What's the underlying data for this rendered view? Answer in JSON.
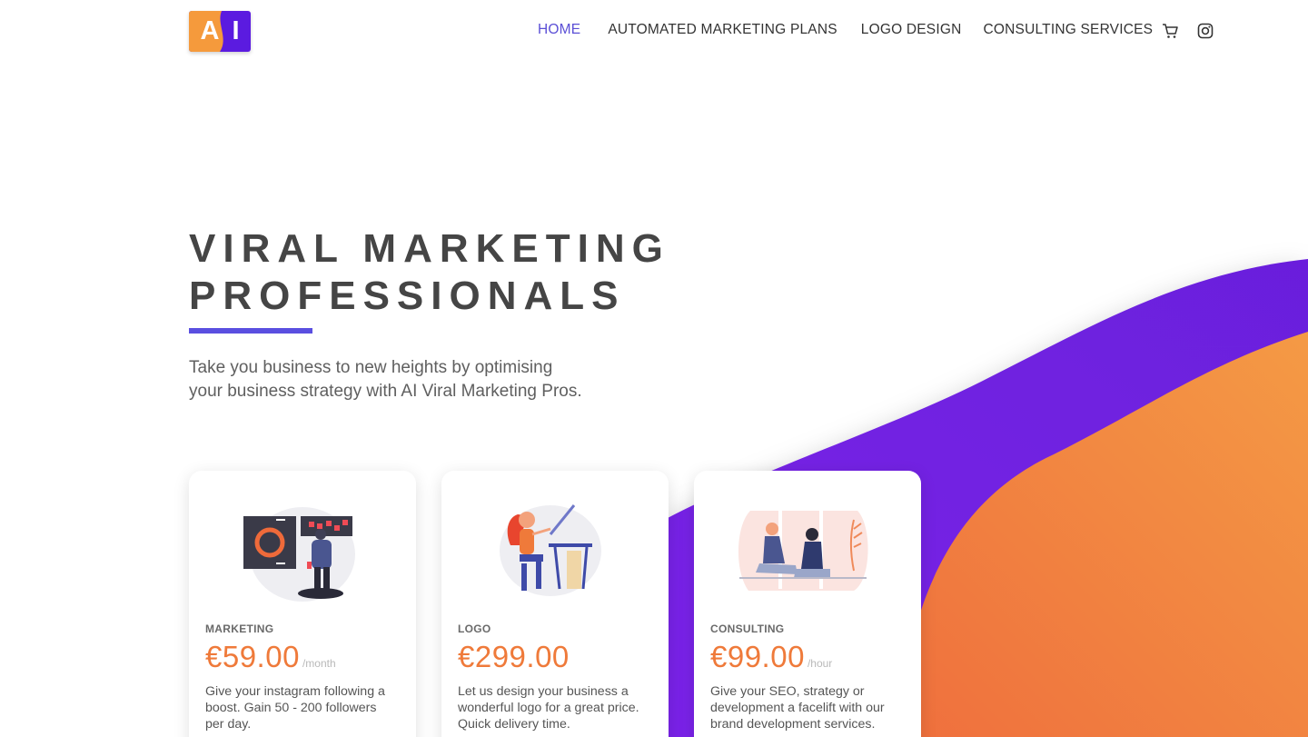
{
  "brand": {
    "logo_letters": [
      "A",
      "I"
    ],
    "colors": {
      "orange": "#f59a3c",
      "purple": "#5b1be0"
    }
  },
  "nav": {
    "items": [
      {
        "label": "HOME",
        "active": true
      },
      {
        "label": "AUTOMATED MARKETING PLANS",
        "active": false
      },
      {
        "label": "LOGO DESIGN",
        "active": false
      },
      {
        "label": "CONSULTING SERVICES",
        "active": false
      }
    ],
    "icons": [
      "cart-icon",
      "instagram-icon"
    ]
  },
  "hero": {
    "title_line1": "VIRAL MARKETING",
    "title_line2": "PROFESSIONALS",
    "subtitle_line1": "Take you business to new heights by optimising",
    "subtitle_line2": "your business strategy with AI Viral Marketing Pros.",
    "accent_color": "#5a4fe0"
  },
  "cards": [
    {
      "label": "MARKETING",
      "price": "€59.00",
      "unit": "/month",
      "desc_lines": [
        "Give your instagram following a",
        "boost. Gain 50 - 200 followers",
        "per day."
      ],
      "illustration": "presentation-illustration"
    },
    {
      "label": "LOGO",
      "price": "€299.00",
      "unit": "",
      "desc_lines": [
        "Let us design your business a",
        "wonderful logo for a great price.",
        "Quick delivery time."
      ],
      "illustration": "designer-illustration"
    },
    {
      "label": "CONSULTING",
      "price": "€99.00",
      "unit": "/hour",
      "desc_lines": [
        "Give your SEO, strategy or",
        "development a facelift with our",
        "brand development services."
      ],
      "illustration": "consulting-illustration"
    }
  ],
  "theme": {
    "price_color": "#ef7a3a",
    "wave_purple": "#6a1fe0",
    "wave_orange": "#f0853f"
  }
}
